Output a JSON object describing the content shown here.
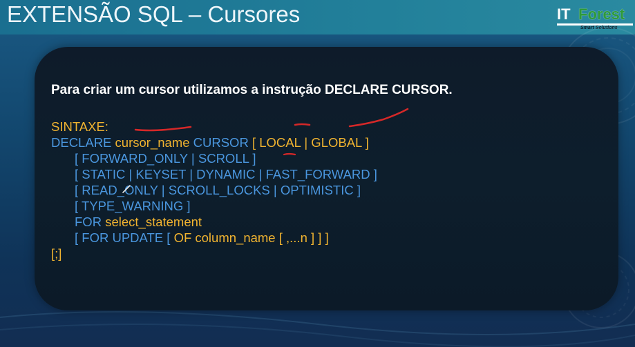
{
  "header": {
    "title": "EXTENSÃO SQL – Cursores",
    "logo": {
      "it": "IT",
      "forest": "Forest",
      "tagline": "Smart Solutions"
    }
  },
  "slide": {
    "intro": "Para criar um cursor utilizamos a instrução DECLARE CURSOR.",
    "syntax_label": "SINTAXE:",
    "lines": [
      [
        "DECLARE ",
        "cursor_name",
        " CURSOR ",
        "[ LOCAL | GLOBAL ]"
      ],
      [
        "[ FORWARD_ONLY | SCROLL ]"
      ],
      [
        "[ STATIC | KEYSET | DYNAMIC | FAST_FORWARD ]"
      ],
      [
        "[ READ_ONLY | SCROLL_LOCKS | OPTIMISTIC ]"
      ],
      [
        "[ TYPE_WARNING ]"
      ],
      [
        "FOR ",
        "select_statement"
      ],
      [
        "[ FOR UPDATE [ ",
        "OF column_name [ ,...n ] ] ]"
      ],
      [
        "[;]"
      ]
    ]
  },
  "colors": {
    "keyword_blue": "#4a96de",
    "identifier_orange": "#f0b330",
    "annotation_red": "#d62828",
    "logo_green": "#2e9a3a"
  }
}
